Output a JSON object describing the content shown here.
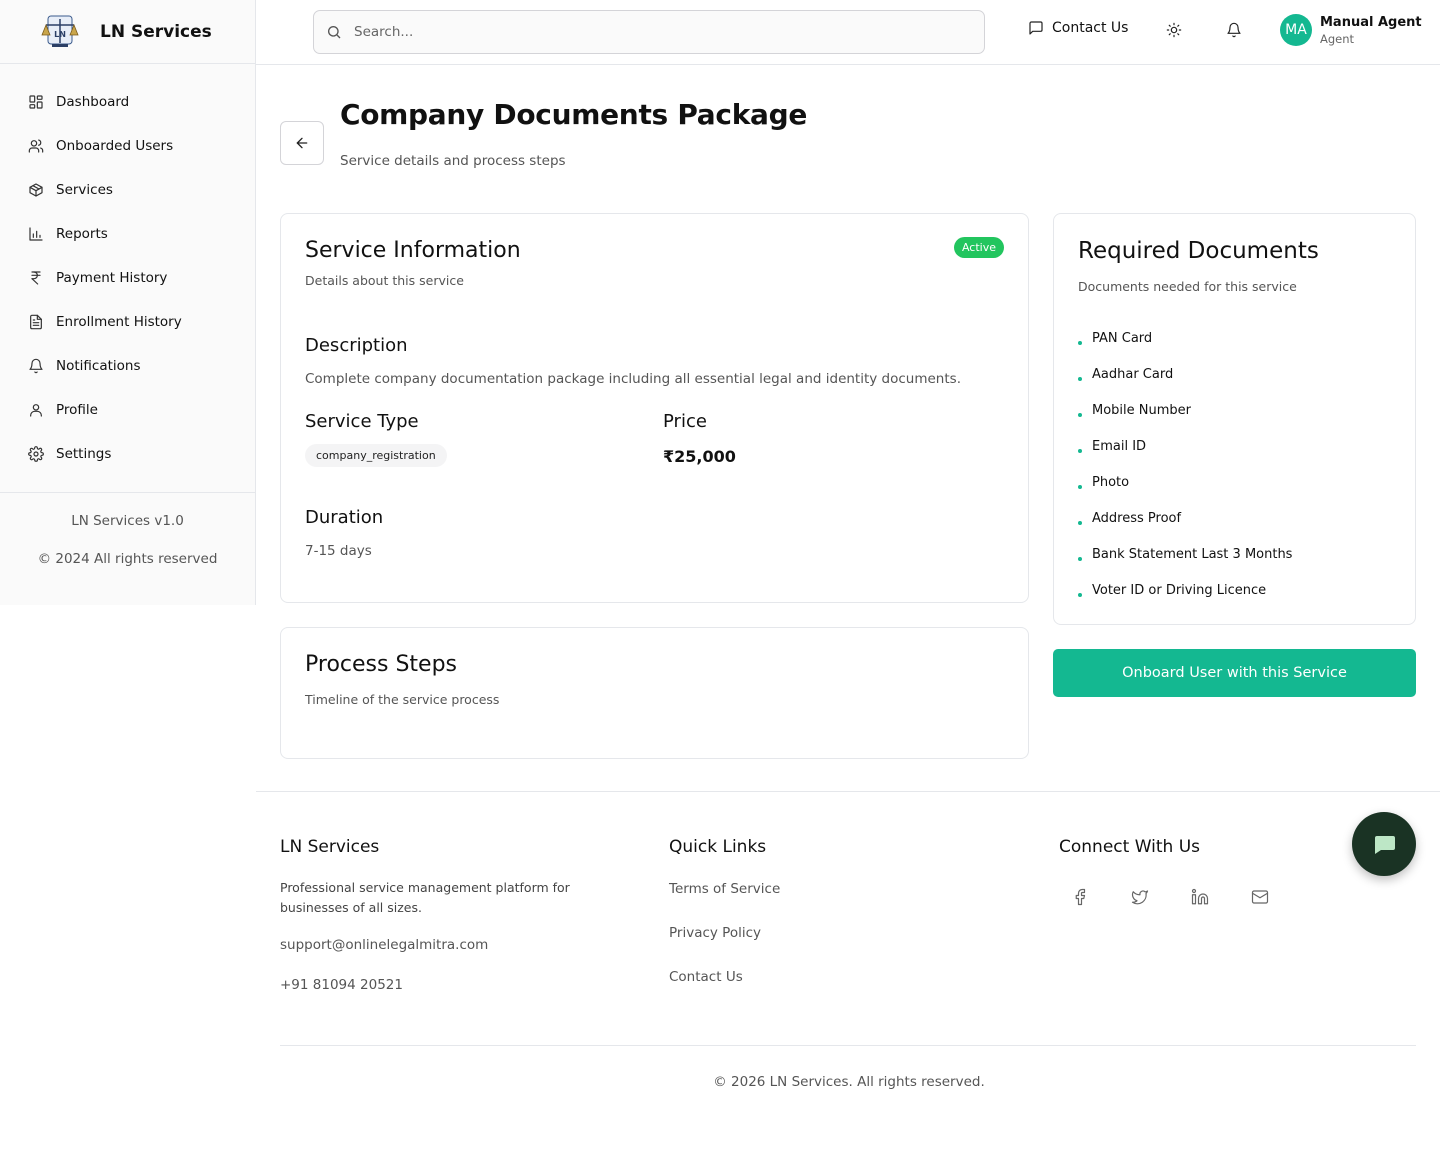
{
  "brand": {
    "name": "LN Services"
  },
  "sidebar": {
    "items": [
      {
        "label": "Dashboard",
        "icon": "dashboard-icon"
      },
      {
        "label": "Onboarded Users",
        "icon": "users-icon"
      },
      {
        "label": "Services",
        "icon": "package-icon"
      },
      {
        "label": "Reports",
        "icon": "bar-chart-icon"
      },
      {
        "label": "Payment History",
        "icon": "rupee-icon"
      },
      {
        "label": "Enrollment History",
        "icon": "file-text-icon"
      },
      {
        "label": "Notifications",
        "icon": "bell-icon"
      },
      {
        "label": "Profile",
        "icon": "user-icon"
      },
      {
        "label": "Settings",
        "icon": "gear-icon"
      }
    ],
    "version": "LN Services v1.0",
    "copyright": "© 2024 All rights reserved"
  },
  "header": {
    "search_placeholder": "Search...",
    "contact_label": "Contact Us",
    "user": {
      "initials": "MA",
      "name": "Manual Agent",
      "role": "Agent"
    }
  },
  "page": {
    "title": "Company Documents Package",
    "subtitle": "Service details and process steps"
  },
  "service_info": {
    "title": "Service Information",
    "subtitle": "Details about this service",
    "status": "Active",
    "description_label": "Description",
    "description": "Complete company documentation package including all essential legal and identity documents.",
    "service_type_label": "Service Type",
    "service_type": "company_registration",
    "price_label": "Price",
    "price": "₹25,000",
    "duration_label": "Duration",
    "duration": "7-15 days"
  },
  "process_steps": {
    "title": "Process Steps",
    "subtitle": "Timeline of the service process"
  },
  "required_documents": {
    "title": "Required Documents",
    "subtitle": "Documents needed for this service",
    "items": [
      "PAN Card",
      "Aadhar Card",
      "Mobile Number",
      "Email ID",
      "Photo",
      "Address Proof",
      "Bank Statement Last 3 Months",
      "Voter ID or Driving Licence"
    ]
  },
  "onboard_button": "Onboard User with this Service",
  "footer": {
    "brand_title": "LN Services",
    "brand_desc": "Professional service management platform for businesses of all sizes.",
    "email": "support@onlinelegalmitra.com",
    "phone": "+91 81094 20521",
    "quick_links_title": "Quick Links",
    "links": [
      "Terms of Service",
      "Privacy Policy",
      "Contact Us"
    ],
    "connect_title": "Connect With Us",
    "socials": [
      "facebook-icon",
      "twitter-icon",
      "linkedin-icon",
      "mail-icon"
    ],
    "copyright": "© 2026 LN Services. All rights reserved."
  },
  "colors": {
    "accent": "#14b891",
    "badge": "#22c55e",
    "chat_fab": "#1a3324"
  }
}
